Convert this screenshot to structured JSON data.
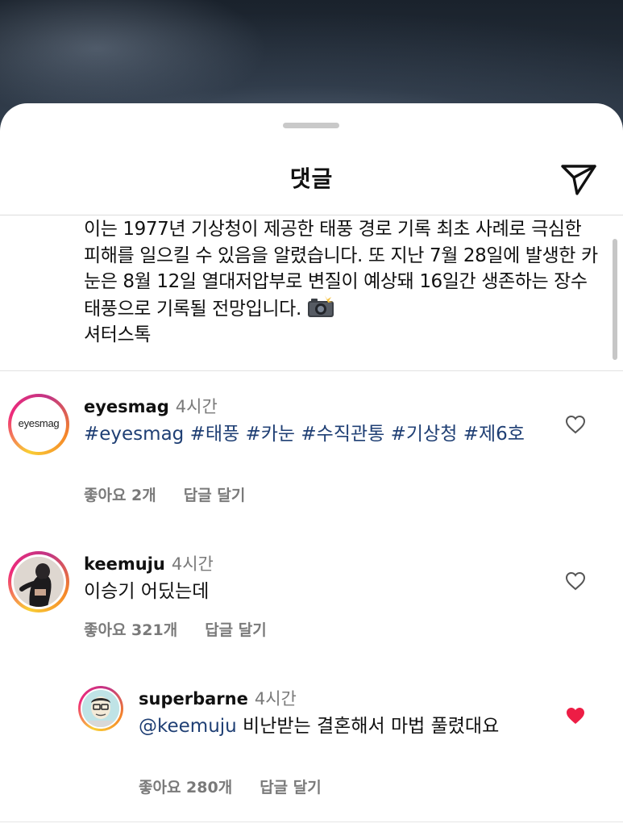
{
  "sheet": {
    "title": "댓글"
  },
  "caption": {
    "text": "이는 1977년 기상청이 제공한 태풍 경로 기록 최초 사례로 극심한 피해를 일으킬 수 있음을 알렸습니다. 또 지난 7월 28일에 발생한 카눈은 8월 12일 열대저압부로 변질이 예상돼 16일간 생존하는 장수 태풍으로 기록될 전망입니다. ",
    "credit": "셔터스톡"
  },
  "comments": [
    {
      "username": "eyesmag",
      "time": "4시간",
      "avatar_text": "eyesmag",
      "hashtags": [
        "#eyesmag",
        "#태풍",
        "#카눈",
        "#수직관통",
        "#기상청",
        "#제6호"
      ],
      "likes": "좋아요 2개",
      "reply": "답글 달기",
      "liked": false
    },
    {
      "username": "keemuju",
      "time": "4시간",
      "text": "이승기 어딨는데",
      "likes": "좋아요 321개",
      "reply": "답글 달기",
      "liked": false
    },
    {
      "username": "superbarne",
      "time": "4시간",
      "mention": "@keemuju",
      "text": " 비난받는 결혼해서 마법 풀렸대요",
      "likes": "좋아요 280개",
      "reply": "답글 달기",
      "liked": true
    }
  ],
  "icons": {
    "send": "paper-plane-icon",
    "camera": "camera-flash-emoji",
    "heart": "heart-icon",
    "heart_filled": "heart-filled-icon"
  },
  "colors": {
    "hashtag": "#1f3f74",
    "liked_heart": "#ed1d45",
    "secondary_text": "#7a7a7a"
  }
}
